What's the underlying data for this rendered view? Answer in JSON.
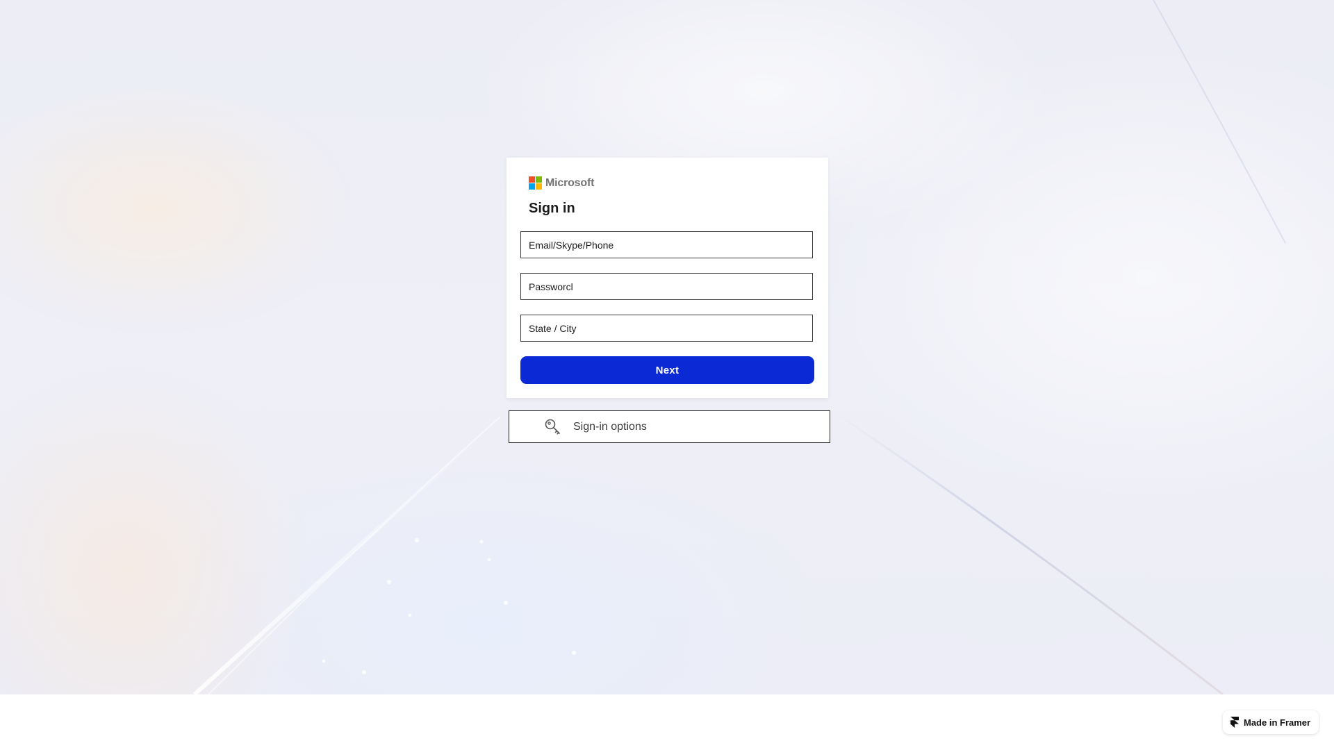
{
  "background": {
    "colors": {
      "base": "#ecedf5"
    }
  },
  "signin": {
    "brand": "Microsoft",
    "logo_colors": [
      "#f25022",
      "#7fba00",
      "#00a4ef",
      "#ffb900"
    ],
    "title": "Sign in",
    "fields": {
      "email_placeholder": "Email/Skype/Phone",
      "password_placeholder": "Passworcl",
      "location_placeholder": "State / City"
    },
    "next_label": "Next",
    "accent_color": "#0b2ad6"
  },
  "options": {
    "icon": "key-icon",
    "label": "Sign-in options"
  },
  "framer_badge": {
    "icon": "framer-icon",
    "label": "Made in Framer"
  }
}
